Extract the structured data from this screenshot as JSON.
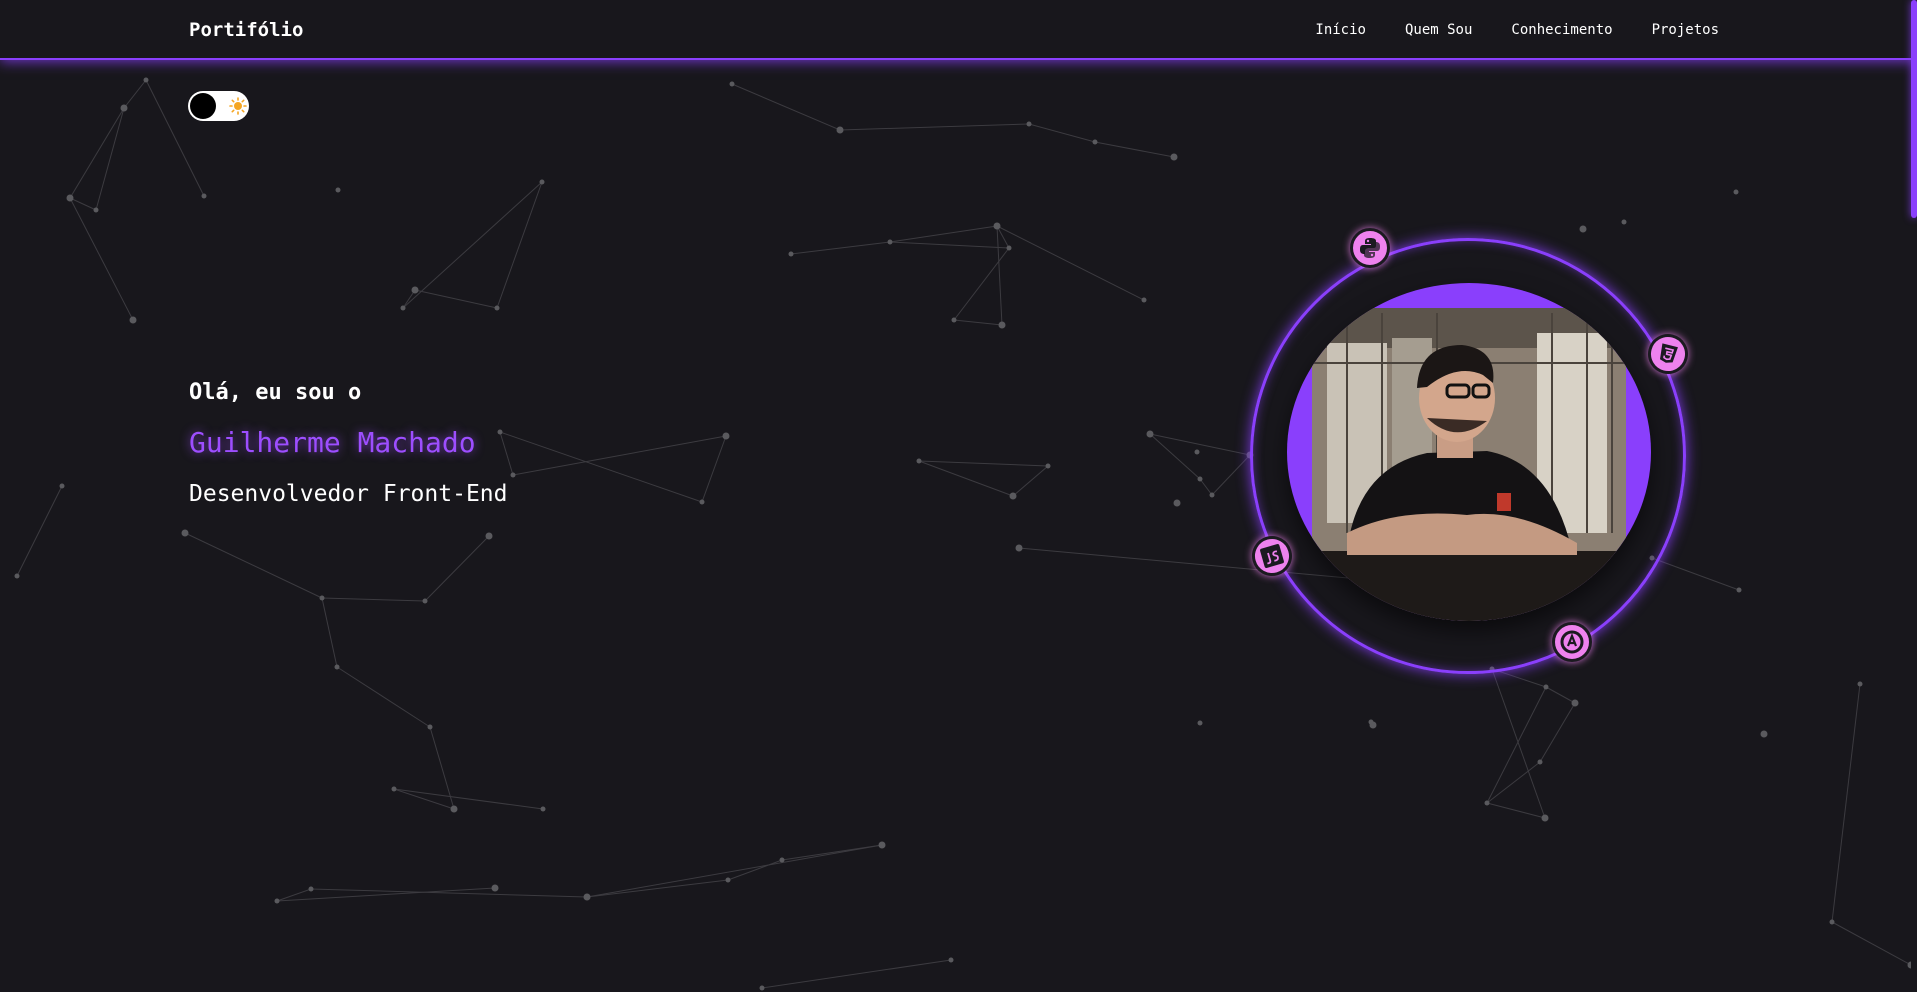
{
  "nav": {
    "brand": "Portifólio",
    "links": [
      {
        "label": "Início"
      },
      {
        "label": "Quem Sou"
      },
      {
        "label": "Conhecimento"
      },
      {
        "label": "Projetos"
      }
    ]
  },
  "theme_toggle": {
    "icon": "sun-icon",
    "state": "dark"
  },
  "hero": {
    "greeting": "Olá, eu sou o",
    "name": "Guilherme Machado",
    "role": "Desenvolvedor Front-End"
  },
  "profile": {
    "orbit_icons": [
      "python-icon",
      "html5-icon",
      "javascript-icon",
      "angular-icon"
    ]
  },
  "colors": {
    "background": "#18171c",
    "accent": "#8a3ffc",
    "name_text": "#9d4eff",
    "orbit_icon": "#ee82ee",
    "particles": "#5a5a5e"
  }
}
